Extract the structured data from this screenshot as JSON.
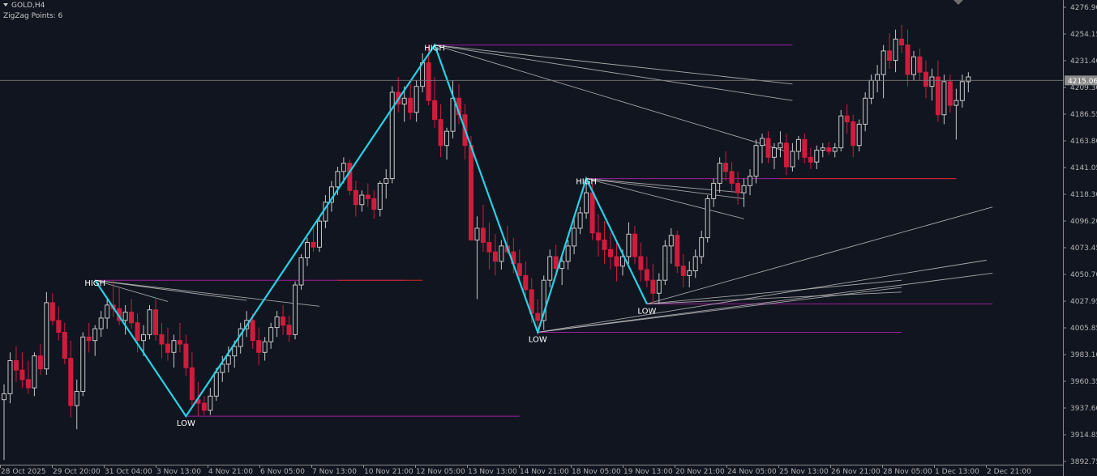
{
  "header": {
    "symbol": "GOLD,H4",
    "indicator": "ZigZag Points: 6"
  },
  "current_price_label": "4215.06",
  "chart_data": {
    "type": "candlestick",
    "symbol": "GOLD,H4",
    "ylim": [
      3892.75,
      4276.9
    ],
    "y_ticks": [
      "4276.90",
      "4254.15",
      "4231.40",
      "4209.30",
      "4186.55",
      "4163.80",
      "4141.05",
      "4118.30",
      "4096.20",
      "4073.45",
      "4050.70",
      "4027.95",
      "4005.85",
      "3983.10",
      "3960.35",
      "3937.60",
      "3914.85",
      "3892.75"
    ],
    "x_ticks": [
      "28 Oct 2025",
      "29 Oct 20:00",
      "31 Oct 04:00",
      "3 Nov 13:00",
      "4 Nov 21:00",
      "6 Nov 05:00",
      "7 Nov 13:00",
      "10 Nov 21:00",
      "12 Nov 05:00",
      "13 Nov 13:00",
      "14 Nov 21:00",
      "18 Nov 05:00",
      "19 Nov 13:00",
      "20 Nov 21:00",
      "24 Nov 05:00",
      "25 Nov 13:00",
      "26 Nov 21:00",
      "28 Nov 05:00",
      "1 Dec 13:00",
      "2 Dec 21:00"
    ],
    "current_price": 4215.06,
    "colors": {
      "bull": "#c8c8c8",
      "bear": "#d01c3c",
      "zigzag": "#26d2e6",
      "level": "#9c1e9c",
      "level_red": "#d02828",
      "fan": "#bebebe",
      "background": "#111520"
    },
    "candles": [
      {
        "o": 3945,
        "h": 3958,
        "l": 3894,
        "c": 3950
      },
      {
        "o": 3950,
        "h": 3985,
        "l": 3942,
        "c": 3978
      },
      {
        "o": 3978,
        "h": 3990,
        "l": 3960,
        "c": 3970
      },
      {
        "o": 3970,
        "h": 3985,
        "l": 3955,
        "c": 3962
      },
      {
        "o": 3962,
        "h": 3978,
        "l": 3950,
        "c": 3955
      },
      {
        "o": 3955,
        "h": 3985,
        "l": 3948,
        "c": 3982
      },
      {
        "o": 3982,
        "h": 3992,
        "l": 3966,
        "c": 3971
      },
      {
        "o": 3971,
        "h": 4036,
        "l": 3966,
        "c": 4027
      },
      {
        "o": 4027,
        "h": 4035,
        "l": 4008,
        "c": 4012
      },
      {
        "o": 4012,
        "h": 4024,
        "l": 3995,
        "c": 4002
      },
      {
        "o": 4002,
        "h": 4010,
        "l": 3975,
        "c": 3980
      },
      {
        "o": 3980,
        "h": 3995,
        "l": 3930,
        "c": 3940
      },
      {
        "o": 3940,
        "h": 3962,
        "l": 3920,
        "c": 3952
      },
      {
        "o": 3952,
        "h": 4002,
        "l": 3948,
        "c": 3998
      },
      {
        "o": 3998,
        "h": 4010,
        "l": 3985,
        "c": 3995
      },
      {
        "o": 3995,
        "h": 4008,
        "l": 3982,
        "c": 4005
      },
      {
        "o": 4005,
        "h": 4020,
        "l": 3998,
        "c": 4014
      },
      {
        "o": 4014,
        "h": 4030,
        "l": 4005,
        "c": 4025
      },
      {
        "o": 4025,
        "h": 4046,
        "l": 4015,
        "c": 4022
      },
      {
        "o": 4022,
        "h": 4040,
        "l": 4008,
        "c": 4012
      },
      {
        "o": 4012,
        "h": 4025,
        "l": 4000,
        "c": 4019
      },
      {
        "o": 4019,
        "h": 4030,
        "l": 4005,
        "c": 4010
      },
      {
        "o": 4010,
        "h": 4018,
        "l": 3985,
        "c": 3995
      },
      {
        "o": 3995,
        "h": 4008,
        "l": 3982,
        "c": 4000
      },
      {
        "o": 4000,
        "h": 4025,
        "l": 3996,
        "c": 4021
      },
      {
        "o": 4021,
        "h": 4030,
        "l": 3995,
        "c": 4000
      },
      {
        "o": 4000,
        "h": 4010,
        "l": 3980,
        "c": 3992
      },
      {
        "o": 3992,
        "h": 4006,
        "l": 3978,
        "c": 3985
      },
      {
        "o": 3985,
        "h": 4000,
        "l": 3972,
        "c": 3995
      },
      {
        "o": 3995,
        "h": 4010,
        "l": 3985,
        "c": 3992
      },
      {
        "o": 3992,
        "h": 4000,
        "l": 3965,
        "c": 3972
      },
      {
        "o": 3972,
        "h": 3985,
        "l": 3940,
        "c": 3945
      },
      {
        "o": 3945,
        "h": 3960,
        "l": 3931,
        "c": 3942
      },
      {
        "o": 3942,
        "h": 3948,
        "l": 3932,
        "c": 3936
      },
      {
        "o": 3936,
        "h": 3955,
        "l": 3932,
        "c": 3948
      },
      {
        "o": 3948,
        "h": 3972,
        "l": 3944,
        "c": 3968
      },
      {
        "o": 3968,
        "h": 3982,
        "l": 3960,
        "c": 3975
      },
      {
        "o": 3975,
        "h": 3990,
        "l": 3968,
        "c": 3982
      },
      {
        "o": 3982,
        "h": 3995,
        "l": 3972,
        "c": 3990
      },
      {
        "o": 3990,
        "h": 4010,
        "l": 3984,
        "c": 4005
      },
      {
        "o": 4005,
        "h": 4020,
        "l": 3998,
        "c": 4012
      },
      {
        "o": 4012,
        "h": 4018,
        "l": 3988,
        "c": 3995
      },
      {
        "o": 3995,
        "h": 4006,
        "l": 3974,
        "c": 3985
      },
      {
        "o": 3985,
        "h": 3998,
        "l": 3978,
        "c": 3994
      },
      {
        "o": 3994,
        "h": 4010,
        "l": 3988,
        "c": 4006
      },
      {
        "o": 4006,
        "h": 4020,
        "l": 3998,
        "c": 4015
      },
      {
        "o": 4015,
        "h": 4025,
        "l": 4000,
        "c": 4008
      },
      {
        "o": 4008,
        "h": 4016,
        "l": 3994,
        "c": 4000
      },
      {
        "o": 4000,
        "h": 4045,
        "l": 3996,
        "c": 4042
      },
      {
        "o": 4042,
        "h": 4068,
        "l": 4038,
        "c": 4065
      },
      {
        "o": 4065,
        "h": 4082,
        "l": 4058,
        "c": 4078
      },
      {
        "o": 4078,
        "h": 4090,
        "l": 4070,
        "c": 4074
      },
      {
        "o": 4074,
        "h": 4100,
        "l": 4070,
        "c": 4096
      },
      {
        "o": 4096,
        "h": 4118,
        "l": 4090,
        "c": 4112
      },
      {
        "o": 4112,
        "h": 4130,
        "l": 4104,
        "c": 4125
      },
      {
        "o": 4125,
        "h": 4142,
        "l": 4118,
        "c": 4138
      },
      {
        "o": 4138,
        "h": 4150,
        "l": 4128,
        "c": 4145
      },
      {
        "o": 4145,
        "h": 4148,
        "l": 4118,
        "c": 4122
      },
      {
        "o": 4122,
        "h": 4130,
        "l": 4100,
        "c": 4110
      },
      {
        "o": 4110,
        "h": 4122,
        "l": 4104,
        "c": 4118
      },
      {
        "o": 4118,
        "h": 4128,
        "l": 4108,
        "c": 4115
      },
      {
        "o": 4115,
        "h": 4122,
        "l": 4098,
        "c": 4106
      },
      {
        "o": 4106,
        "h": 4130,
        "l": 4100,
        "c": 4128
      },
      {
        "o": 4128,
        "h": 4140,
        "l": 4115,
        "c": 4132
      },
      {
        "o": 4132,
        "h": 4210,
        "l": 4128,
        "c": 4205
      },
      {
        "o": 4205,
        "h": 4218,
        "l": 4188,
        "c": 4195
      },
      {
        "o": 4195,
        "h": 4210,
        "l": 4180,
        "c": 4200
      },
      {
        "o": 4200,
        "h": 4212,
        "l": 4182,
        "c": 4188
      },
      {
        "o": 4188,
        "h": 4215,
        "l": 4180,
        "c": 4210
      },
      {
        "o": 4210,
        "h": 4238,
        "l": 4205,
        "c": 4230
      },
      {
        "o": 4230,
        "h": 4245,
        "l": 4194,
        "c": 4198
      },
      {
        "o": 4198,
        "h": 4218,
        "l": 4175,
        "c": 4182
      },
      {
        "o": 4182,
        "h": 4195,
        "l": 4150,
        "c": 4160
      },
      {
        "o": 4160,
        "h": 4175,
        "l": 4148,
        "c": 4172
      },
      {
        "o": 4172,
        "h": 4215,
        "l": 4166,
        "c": 4200
      },
      {
        "o": 4200,
        "h": 4212,
        "l": 4178,
        "c": 4186
      },
      {
        "o": 4186,
        "h": 4195,
        "l": 4148,
        "c": 4160
      },
      {
        "o": 4160,
        "h": 4168,
        "l": 4100,
        "c": 4080
      },
      {
        "o": 4080,
        "h": 4100,
        "l": 4030,
        "c": 4090
      },
      {
        "o": 4090,
        "h": 4110,
        "l": 4070,
        "c": 4078
      },
      {
        "o": 4078,
        "h": 4095,
        "l": 4055,
        "c": 4070
      },
      {
        "o": 4070,
        "h": 4085,
        "l": 4050,
        "c": 4062
      },
      {
        "o": 4062,
        "h": 4080,
        "l": 4055,
        "c": 4075
      },
      {
        "o": 4075,
        "h": 4092,
        "l": 4068,
        "c": 4070
      },
      {
        "o": 4070,
        "h": 4082,
        "l": 4052,
        "c": 4060
      },
      {
        "o": 4060,
        "h": 4072,
        "l": 4045,
        "c": 4050
      },
      {
        "o": 4050,
        "h": 4062,
        "l": 4030,
        "c": 4038
      },
      {
        "o": 4038,
        "h": 4048,
        "l": 4010,
        "c": 4018
      },
      {
        "o": 4018,
        "h": 4030,
        "l": 4002,
        "c": 4012
      },
      {
        "o": 4012,
        "h": 4050,
        "l": 4004,
        "c": 4046
      },
      {
        "o": 4046,
        "h": 4072,
        "l": 4040,
        "c": 4066
      },
      {
        "o": 4066,
        "h": 4076,
        "l": 4050,
        "c": 4056
      },
      {
        "o": 4056,
        "h": 4066,
        "l": 4042,
        "c": 4062
      },
      {
        "o": 4062,
        "h": 4080,
        "l": 4055,
        "c": 4075
      },
      {
        "o": 4075,
        "h": 4098,
        "l": 4068,
        "c": 4090
      },
      {
        "o": 4090,
        "h": 4108,
        "l": 4085,
        "c": 4103
      },
      {
        "o": 4103,
        "h": 4130,
        "l": 4098,
        "c": 4120
      },
      {
        "o": 4120,
        "h": 4128,
        "l": 4080,
        "c": 4086
      },
      {
        "o": 4086,
        "h": 4102,
        "l": 4066,
        "c": 4080
      },
      {
        "o": 4080,
        "h": 4096,
        "l": 4060,
        "c": 4072
      },
      {
        "o": 4072,
        "h": 4086,
        "l": 4055,
        "c": 4066
      },
      {
        "o": 4066,
        "h": 4078,
        "l": 4045,
        "c": 4058
      },
      {
        "o": 4058,
        "h": 4072,
        "l": 4050,
        "c": 4066
      },
      {
        "o": 4066,
        "h": 4095,
        "l": 4060,
        "c": 4085
      },
      {
        "o": 4085,
        "h": 4092,
        "l": 4060,
        "c": 4066
      },
      {
        "o": 4066,
        "h": 4078,
        "l": 4045,
        "c": 4055
      },
      {
        "o": 4055,
        "h": 4066,
        "l": 4040,
        "c": 4046
      },
      {
        "o": 4046,
        "h": 4060,
        "l": 4026,
        "c": 4035
      },
      {
        "o": 4035,
        "h": 4052,
        "l": 4026,
        "c": 4046
      },
      {
        "o": 4046,
        "h": 4080,
        "l": 4042,
        "c": 4075
      },
      {
        "o": 4075,
        "h": 4090,
        "l": 4060,
        "c": 4084
      },
      {
        "o": 4084,
        "h": 4088,
        "l": 4052,
        "c": 4058
      },
      {
        "o": 4058,
        "h": 4068,
        "l": 4040,
        "c": 4050
      },
      {
        "o": 4050,
        "h": 4062,
        "l": 4040,
        "c": 4054
      },
      {
        "o": 4054,
        "h": 4072,
        "l": 4048,
        "c": 4066
      },
      {
        "o": 4066,
        "h": 4088,
        "l": 4060,
        "c": 4082
      },
      {
        "o": 4082,
        "h": 4118,
        "l": 4078,
        "c": 4115
      },
      {
        "o": 4115,
        "h": 4132,
        "l": 4108,
        "c": 4128
      },
      {
        "o": 4128,
        "h": 4150,
        "l": 4120,
        "c": 4145
      },
      {
        "o": 4145,
        "h": 4155,
        "l": 4130,
        "c": 4138
      },
      {
        "o": 4138,
        "h": 4146,
        "l": 4120,
        "c": 4128
      },
      {
        "o": 4128,
        "h": 4138,
        "l": 4110,
        "c": 4120
      },
      {
        "o": 4120,
        "h": 4132,
        "l": 4108,
        "c": 4126
      },
      {
        "o": 4126,
        "h": 4140,
        "l": 4118,
        "c": 4134
      },
      {
        "o": 4134,
        "h": 4165,
        "l": 4128,
        "c": 4160
      },
      {
        "o": 4160,
        "h": 4170,
        "l": 4145,
        "c": 4166
      },
      {
        "o": 4166,
        "h": 4172,
        "l": 4145,
        "c": 4150
      },
      {
        "o": 4150,
        "h": 4162,
        "l": 4140,
        "c": 4158
      },
      {
        "o": 4158,
        "h": 4172,
        "l": 4150,
        "c": 4162
      },
      {
        "o": 4162,
        "h": 4170,
        "l": 4135,
        "c": 4142
      },
      {
        "o": 4142,
        "h": 4162,
        "l": 4138,
        "c": 4155
      },
      {
        "o": 4155,
        "h": 4168,
        "l": 4148,
        "c": 4165
      },
      {
        "o": 4165,
        "h": 4170,
        "l": 4145,
        "c": 4150
      },
      {
        "o": 4150,
        "h": 4158,
        "l": 4140,
        "c": 4146
      },
      {
        "o": 4146,
        "h": 4160,
        "l": 4140,
        "c": 4156
      },
      {
        "o": 4156,
        "h": 4162,
        "l": 4150,
        "c": 4158
      },
      {
        "o": 4158,
        "h": 4163,
        "l": 4152,
        "c": 4155
      },
      {
        "o": 4155,
        "h": 4162,
        "l": 4150,
        "c": 4158
      },
      {
        "o": 4158,
        "h": 4190,
        "l": 4155,
        "c": 4185
      },
      {
        "o": 4185,
        "h": 4195,
        "l": 4170,
        "c": 4180
      },
      {
        "o": 4180,
        "h": 4186,
        "l": 4150,
        "c": 4160
      },
      {
        "o": 4160,
        "h": 4182,
        "l": 4155,
        "c": 4178
      },
      {
        "o": 4178,
        "h": 4205,
        "l": 4172,
        "c": 4200
      },
      {
        "o": 4200,
        "h": 4220,
        "l": 4195,
        "c": 4215
      },
      {
        "o": 4215,
        "h": 4228,
        "l": 4205,
        "c": 4220
      },
      {
        "o": 4220,
        "h": 4245,
        "l": 4200,
        "c": 4240
      },
      {
        "o": 4240,
        "h": 4255,
        "l": 4225,
        "c": 4232
      },
      {
        "o": 4232,
        "h": 4258,
        "l": 4222,
        "c": 4250
      },
      {
        "o": 4250,
        "h": 4262,
        "l": 4238,
        "c": 4245
      },
      {
        "o": 4245,
        "h": 4258,
        "l": 4210,
        "c": 4220
      },
      {
        "o": 4220,
        "h": 4240,
        "l": 4215,
        "c": 4235
      },
      {
        "o": 4235,
        "h": 4242,
        "l": 4215,
        "c": 4222
      },
      {
        "o": 4222,
        "h": 4232,
        "l": 4200,
        "c": 4210
      },
      {
        "o": 4210,
        "h": 4225,
        "l": 4198,
        "c": 4218
      },
      {
        "o": 4218,
        "h": 4232,
        "l": 4180,
        "c": 4186
      },
      {
        "o": 4186,
        "h": 4220,
        "l": 4178,
        "c": 4214
      },
      {
        "o": 4214,
        "h": 4220,
        "l": 4188,
        "c": 4194
      },
      {
        "o": 4194,
        "h": 4208,
        "l": 4165,
        "c": 4198
      },
      {
        "o": 4198,
        "h": 4220,
        "l": 4192,
        "c": 4214
      },
      {
        "o": 4214,
        "h": 4222,
        "l": 4205,
        "c": 4218
      }
    ],
    "zigzag": [
      {
        "bar": 15,
        "price": 4046,
        "label": "HIGH"
      },
      {
        "bar": 30,
        "price": 3931,
        "label": "LOW"
      },
      {
        "bar": 71,
        "price": 4245,
        "label": "HIGH"
      },
      {
        "bar": 88,
        "price": 4002,
        "label": "LOW"
      },
      {
        "bar": 96,
        "price": 4132,
        "label": "HIGH"
      },
      {
        "bar": 106,
        "price": 4026,
        "label": "LOW"
      }
    ]
  }
}
